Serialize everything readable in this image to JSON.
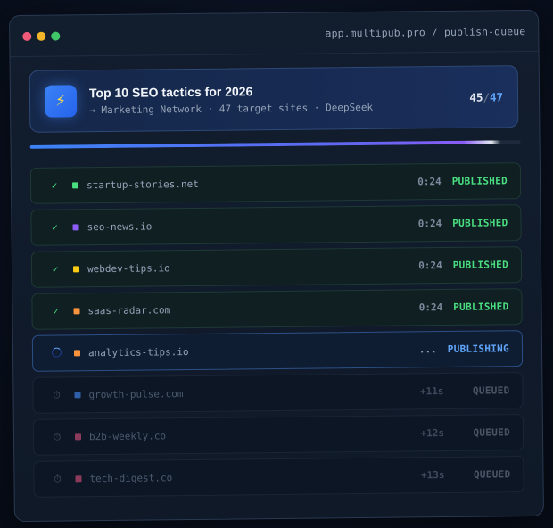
{
  "window": {
    "url": "app.multipub.pro / publish-queue",
    "traffic_lights": [
      "#f05a78",
      "#f3b62a",
      "#3fc769"
    ]
  },
  "header": {
    "icon": "bolt-icon",
    "title": "Top 10 SEO tactics for 2026",
    "subtitle": "→ Marketing Network · 47 target sites · DeepSeek",
    "done": "45",
    "separator": "/",
    "total": "47"
  },
  "progress": {
    "fraction": 0.96
  },
  "queue": [
    {
      "site": "startup-stories.net",
      "color": "#4ade80",
      "time": "0:24",
      "status": "PUBLISHED",
      "state": "published"
    },
    {
      "site": "seo-news.io",
      "color": "#8b5cf6",
      "time": "0:24",
      "status": "PUBLISHED",
      "state": "published"
    },
    {
      "site": "webdev-tips.io",
      "color": "#facc15",
      "time": "0:24",
      "status": "PUBLISHED",
      "state": "published"
    },
    {
      "site": "saas-radar.com",
      "color": "#fb923c",
      "time": "0:24",
      "status": "PUBLISHED",
      "state": "published"
    },
    {
      "site": "analytics-tips.io",
      "color": "#fb923c",
      "time": "...",
      "status": "PUBLISHING",
      "state": "publishing"
    },
    {
      "site": "growth-pulse.com",
      "color": "#2f5fa8",
      "time": "+11s",
      "status": "QUEUED",
      "state": "queued"
    },
    {
      "site": "b2b-weekly.co",
      "color": "#8b3a5c",
      "time": "+12s",
      "status": "QUEUED",
      "state": "queued"
    },
    {
      "site": "tech-digest.co",
      "color": "#8b3a5c",
      "time": "+13s",
      "status": "QUEUED",
      "state": "queued"
    }
  ]
}
